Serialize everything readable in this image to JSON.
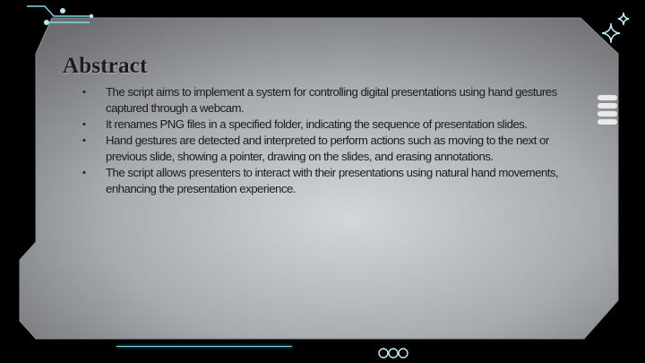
{
  "slide": {
    "title": "Abstract",
    "bullets": [
      "The script aims to implement a system for controlling digital presentations using hand gestures captured through a webcam.",
      "It renames PNG files in a specified folder, indicating the sequence of presentation slides.",
      "Hand gestures are detected and interpreted to perform actions such as moving to the next or previous slide, showing a pointer, drawing on the slides, and erasing annotations.",
      "The script allows presenters to interact with their presentations using natural hand movements, enhancing the presentation experience."
    ],
    "bullet_symbol": "•"
  },
  "decor": {
    "icons": [
      "sparkle-icon",
      "stacked-bars-icon",
      "three-circles-icon",
      "circuit-lines-icon"
    ],
    "accent_color": "#6fd3e8",
    "panel_gradient": [
      "#d6dadf",
      "#6f7174"
    ]
  }
}
